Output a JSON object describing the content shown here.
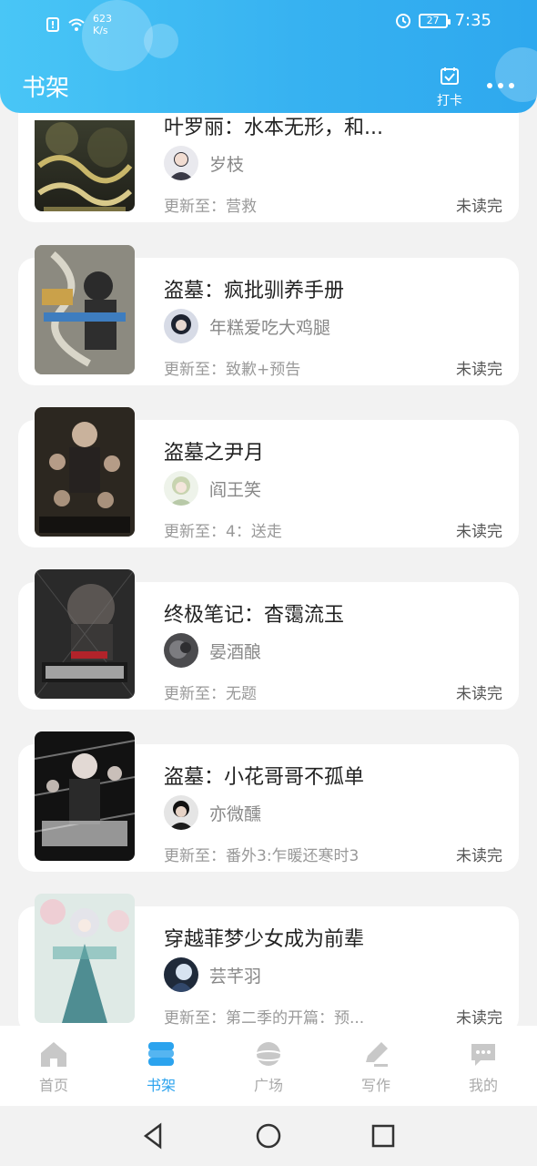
{
  "status_bar": {
    "speed_value": "623",
    "speed_unit": "K/s",
    "battery": "27",
    "time": "7:35"
  },
  "header": {
    "title": "书架",
    "checkin_label": "打卡"
  },
  "update_prefix": "更新至：",
  "books": [
    {
      "title": "叶罗丽：水本无形，和...",
      "author": "岁枝",
      "update": "营救",
      "status": "未读完"
    },
    {
      "title": "盗墓：疯批驯养手册",
      "author": "年糕爱吃大鸡腿",
      "update": "致歉+预告",
      "status": "未读完"
    },
    {
      "title": "盗墓之尹月",
      "author": "阎王笑",
      "update": "4：送走",
      "status": "未读完"
    },
    {
      "title": "终极笔记：杳霭流玉",
      "author": "晏酒酿",
      "update": "无题",
      "status": "未读完"
    },
    {
      "title": "盗墓：小花哥哥不孤单",
      "author": "亦微醺",
      "update": "番外3:乍暖还寒时3",
      "status": "未读完"
    },
    {
      "title": "穿越菲梦少女成为前辈",
      "author": "芸芊羽",
      "update": "第二季的开篇：预...",
      "status": "未读完"
    }
  ],
  "tabs": [
    {
      "label": "首页",
      "icon": "home-icon",
      "active": false
    },
    {
      "label": "书架",
      "icon": "bookshelf-icon",
      "active": true
    },
    {
      "label": "广场",
      "icon": "planet-icon",
      "active": false
    },
    {
      "label": "写作",
      "icon": "pen-icon",
      "active": false
    },
    {
      "label": "我的",
      "icon": "chat-bubble-icon",
      "active": false
    }
  ],
  "colors": {
    "accent": "#2ba3ee",
    "header_start": "#49c6f6",
    "header_end": "#2ea8ee",
    "tab_inactive": "#c8c8c8"
  }
}
